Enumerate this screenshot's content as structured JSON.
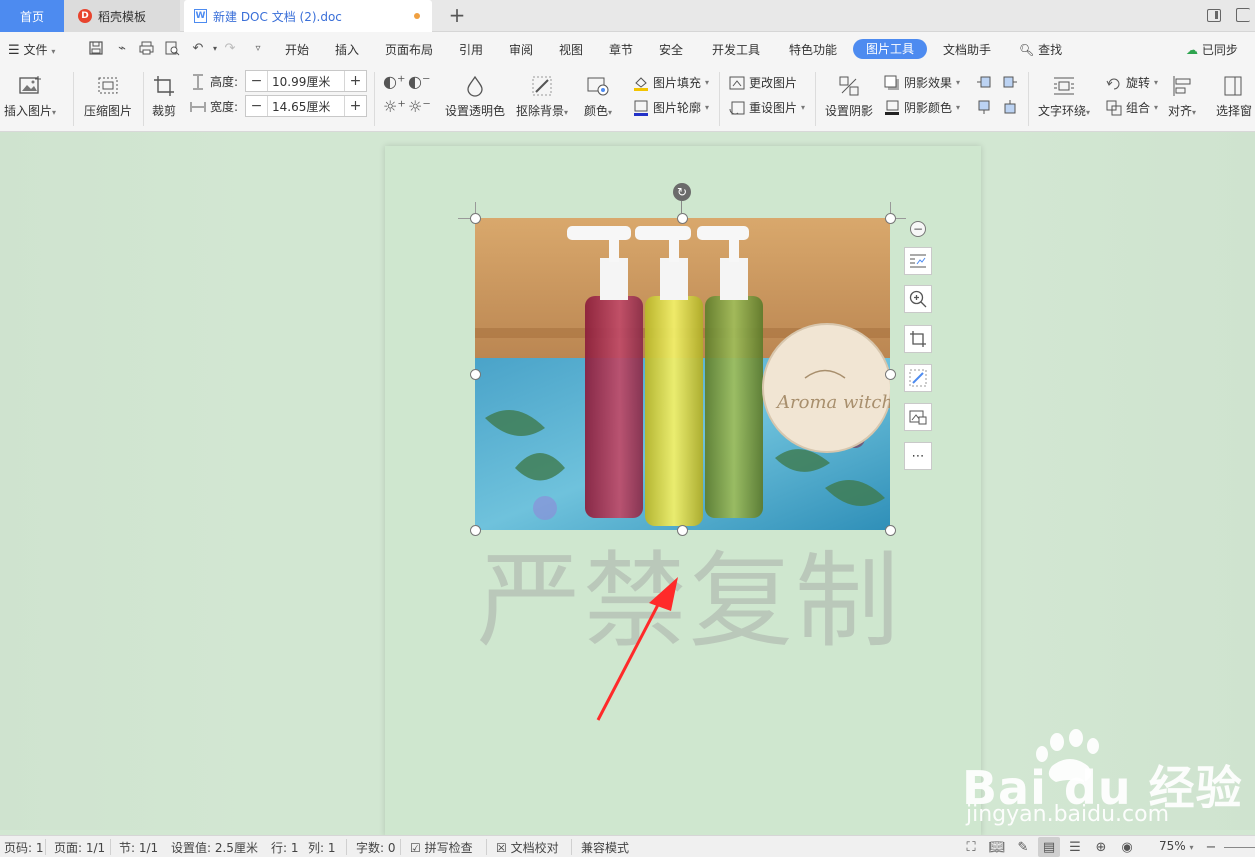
{
  "tabs": {
    "home": "首页",
    "template": "稻壳模板",
    "document": "新建 DOC 文档 (2).doc"
  },
  "menu": {
    "file": "文件",
    "items": [
      "开始",
      "插入",
      "页面布局",
      "引用",
      "审阅",
      "视图",
      "章节",
      "安全",
      "开发工具",
      "特色功能"
    ],
    "active": "图片工具",
    "after": "文档助手",
    "search": "查找",
    "sync": "已同步"
  },
  "ribbon": {
    "insert_picture": "插入图片",
    "compress_picture": "压缩图片",
    "crop": "裁剪",
    "height_label": "高度:",
    "height_value": "10.99厘米",
    "width_label": "宽度:",
    "width_value": "14.65厘米",
    "set_transparent": "设置透明色",
    "remove_background": "抠除背景",
    "color": "颜色",
    "picture_fill": "图片填充",
    "picture_outline": "图片轮廓",
    "change_picture": "更改图片",
    "reset_picture": "重设图片",
    "set_shadow": "设置阴影",
    "shadow_effect": "阴影效果",
    "shadow_color": "阴影颜色",
    "text_wrap": "文字环绕",
    "rotate": "旋转",
    "group": "组合",
    "align": "对齐",
    "selection_pane": "选择窗"
  },
  "document": {
    "watermark": "严禁复制",
    "photo_brand": "Aroma witch"
  },
  "side_tools": [
    "layout-options",
    "zoom-in",
    "crop",
    "remove-bg",
    "change-picture",
    "more"
  ],
  "overlay": {
    "baidu_text": "Bai du 经验",
    "baidu_url": "jingyan.baidu.com"
  },
  "status": {
    "page_num": "页码: 1",
    "pages": "页面: 1/1",
    "section": "节: 1/1",
    "setting": "设置值: 2.5厘米",
    "row": "行: 1",
    "col": "列: 1",
    "word_count": "字数: 0",
    "spell_check": "拼写检查",
    "doc_proof": "文档校对",
    "compat": "兼容模式",
    "zoom": "75%"
  },
  "colors": {
    "accent": "#4d8bf0",
    "page_bg": "#cfe7cf",
    "arrow": "#ff2a2a"
  }
}
